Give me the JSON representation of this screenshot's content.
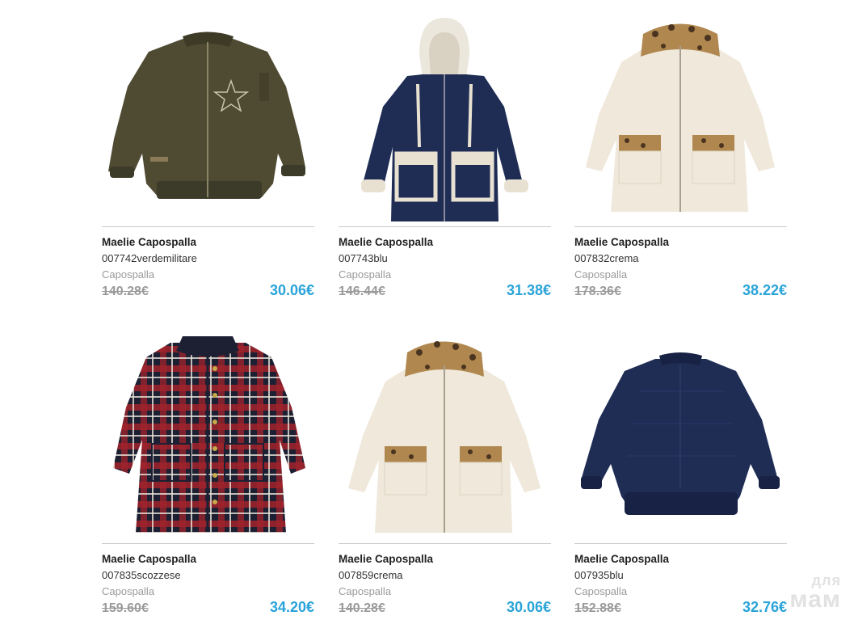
{
  "products": [
    {
      "brand": "Maelie Capospalla",
      "code": "007742verdemilitare",
      "category": "Capospalla",
      "old_price": "140.28€",
      "price": "30.06€",
      "image_icon": "bomber-jacket-green-icon"
    },
    {
      "brand": "Maelie Capospalla",
      "code": "007743blu",
      "category": "Capospalla",
      "old_price": "146.44€",
      "price": "31.38€",
      "image_icon": "hooded-coat-navy-icon"
    },
    {
      "brand": "Maelie Capospalla",
      "code": "007832crema",
      "category": "Capospalla",
      "old_price": "178.36€",
      "price": "38.22€",
      "image_icon": "cream-coat-leopard-icon"
    },
    {
      "brand": "Maelie Capospalla",
      "code": "007835scozzese",
      "category": "Capospalla",
      "old_price": "159.60€",
      "price": "34.20€",
      "image_icon": "tartan-coat-icon"
    },
    {
      "brand": "Maelie Capospalla",
      "code": "007859crema",
      "category": "Capospalla",
      "old_price": "140.28€",
      "price": "30.06€",
      "image_icon": "cream-coat-leopard-icon"
    },
    {
      "brand": "Maelie Capospalla",
      "code": "007935blu",
      "category": "Capospalla",
      "old_price": "152.88€",
      "price": "32.76€",
      "image_icon": "bomber-jacket-navy-icon"
    }
  ],
  "watermark": {
    "line1": "для",
    "line2": "мам"
  },
  "colors": {
    "price": "#29a3d8",
    "old_price": "#9a9a9a",
    "divider": "#c9c9c9"
  }
}
